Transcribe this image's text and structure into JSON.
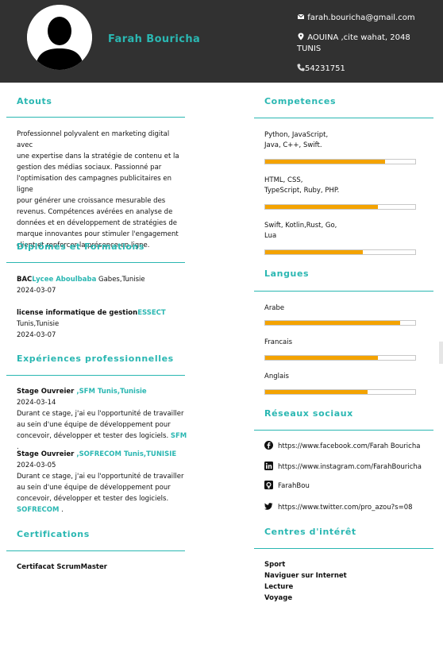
{
  "header": {
    "name": "Farah Bouricha",
    "email": "farah.bouricha@gmail.com",
    "address_line1": "AOUINA ,cite wahat, 2048",
    "address_line2": "TUNIS",
    "phone": "54231751"
  },
  "atouts": {
    "title": "Atouts",
    "lines": [
      "Professionnel polyvalent en marketing digital avec",
      "une expertise dans la stratégie de contenu et la",
      "gestion des médias sociaux. Passionné par",
      "l'optimisation des campagnes publicitaires en ligne",
      "pour générer une croissance mesurable des",
      "revenus. Compétences avérées en analyse de",
      "données et en développement de stratégies de",
      "marque innovantes pour stimuler l'engagement",
      "client et renforcer la présence en ligne."
    ]
  },
  "diplomes": {
    "title": "Diplômes et Formations",
    "items": [
      {
        "degree": "BAC",
        "school": "Lycee Aboulbaba",
        "place": " Gabes,Tunisie",
        "date": "2024-03-07"
      },
      {
        "degree": "license informatique de gestion",
        "school": "ESSECT",
        "place": "Tunis,Tunisie",
        "date": "2024-03-07"
      }
    ]
  },
  "experiences": {
    "title": "Expériences professionnelles",
    "items": [
      {
        "role": "Stage Ouvreier",
        "company": " ,SFM Tunis,Tunisie",
        "date": "2024-03-14",
        "lines": [
          "Durant ce stage, j'ai eu l'opportunité de travailler",
          "au sein d'une équipe de développement pour",
          "concevoir, développer et tester des logiciels."
        ],
        "tail": "SFM",
        "tail_suffix": " ."
      },
      {
        "role": "Stage Ouvreier",
        "company": " ,SOFRECOM Tunis,TUNISIE",
        "date": "2024-03-05",
        "lines": [
          "Durant ce stage, j'ai eu l'opportunité de travailler",
          "au sein d'une équipe de développement pour",
          "concevoir, développer et tester des logiciels."
        ],
        "tail": "SOFRECOM",
        "tail_suffix": " ."
      }
    ]
  },
  "certifications": {
    "title": "Certifications",
    "items": [
      "Certifacat ScrumMaster"
    ]
  },
  "competences": {
    "title": "Competences",
    "items": [
      {
        "line1": "Python, JavaScript,",
        "line2": "Java, C++, Swift.",
        "level": 0.8
      },
      {
        "line1": "HTML, CSS,",
        "line2": "TypeScript, Ruby, PHP.",
        "level": 0.75
      },
      {
        "line1": "Swift, Kotlin,Rust, Go,",
        "line2": "Lua",
        "level": 0.65
      }
    ]
  },
  "langues": {
    "title": "Langues",
    "items": [
      {
        "name": "Arabe",
        "level": 0.9
      },
      {
        "name": "Francais",
        "level": 0.75
      },
      {
        "name": "Anglais",
        "level": 0.68
      }
    ]
  },
  "reseaux": {
    "title": "Réseaux sociaux",
    "items": [
      {
        "icon": "facebook-icon",
        "text": "https://www.facebook.com/Farah Bouricha"
      },
      {
        "icon": "linkedin-icon",
        "text": "https://www.instagram.com/FarahBouricha"
      },
      {
        "icon": "github-icon",
        "text": "FarahBou"
      },
      {
        "icon": "twitter-icon",
        "text": "https://www.twitter.com/pro_azou?s=08"
      }
    ]
  },
  "interets": {
    "title": "Centres d'intérêt",
    "items": [
      "Sport",
      "Naviguer sur Internet",
      "Lecture",
      "Voyage"
    ]
  },
  "colors": {
    "accent": "#2ab7b2",
    "header_bg": "#313131",
    "bar_fill": "#f4a300"
  }
}
